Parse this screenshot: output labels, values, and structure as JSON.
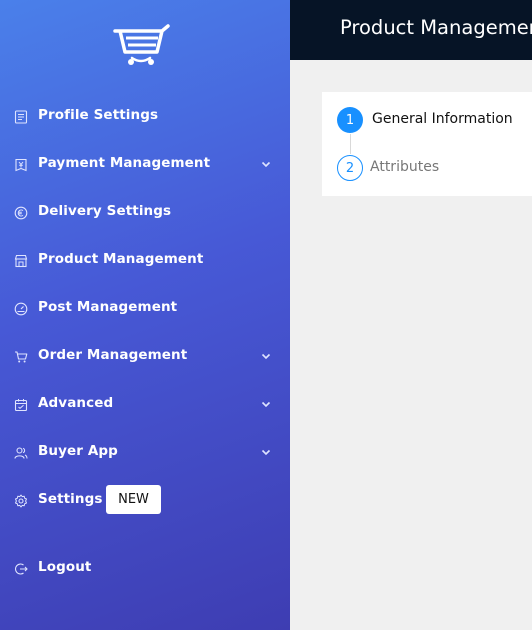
{
  "app": {
    "logo_icon": "shopping-cart-logo",
    "accent_color": "#1890ff",
    "sidebar_gradient": [
      "#4a80ea",
      "#3e3db2"
    ],
    "topbar_color": "#061426"
  },
  "sidebar": {
    "items": [
      {
        "label": "Profile Settings",
        "icon": "profile-list-icon",
        "expandable": false
      },
      {
        "label": "Payment Management",
        "icon": "payment-yen-icon",
        "expandable": true
      },
      {
        "label": "Delivery Settings",
        "icon": "euro-circle-icon",
        "expandable": false
      },
      {
        "label": "Product Management",
        "icon": "storefront-icon",
        "expandable": false
      },
      {
        "label": "Post Management",
        "icon": "dashboard-gauge-icon",
        "expandable": false
      },
      {
        "label": "Order Management",
        "icon": "cart-icon",
        "expandable": true
      },
      {
        "label": "Advanced",
        "icon": "calendar-check-icon",
        "expandable": true
      },
      {
        "label": "Buyer App",
        "icon": "users-icon",
        "expandable": true
      },
      {
        "label": "Settings",
        "icon": "gear-icon",
        "expandable": false,
        "badge": "NEW"
      },
      {
        "label": "Logout",
        "icon": "logout-icon",
        "expandable": false
      }
    ]
  },
  "header": {
    "title": "Product Management"
  },
  "steps": [
    {
      "number": "1",
      "label": "General Information",
      "status": "active"
    },
    {
      "number": "2",
      "label": "Attributes",
      "status": "pending"
    }
  ]
}
